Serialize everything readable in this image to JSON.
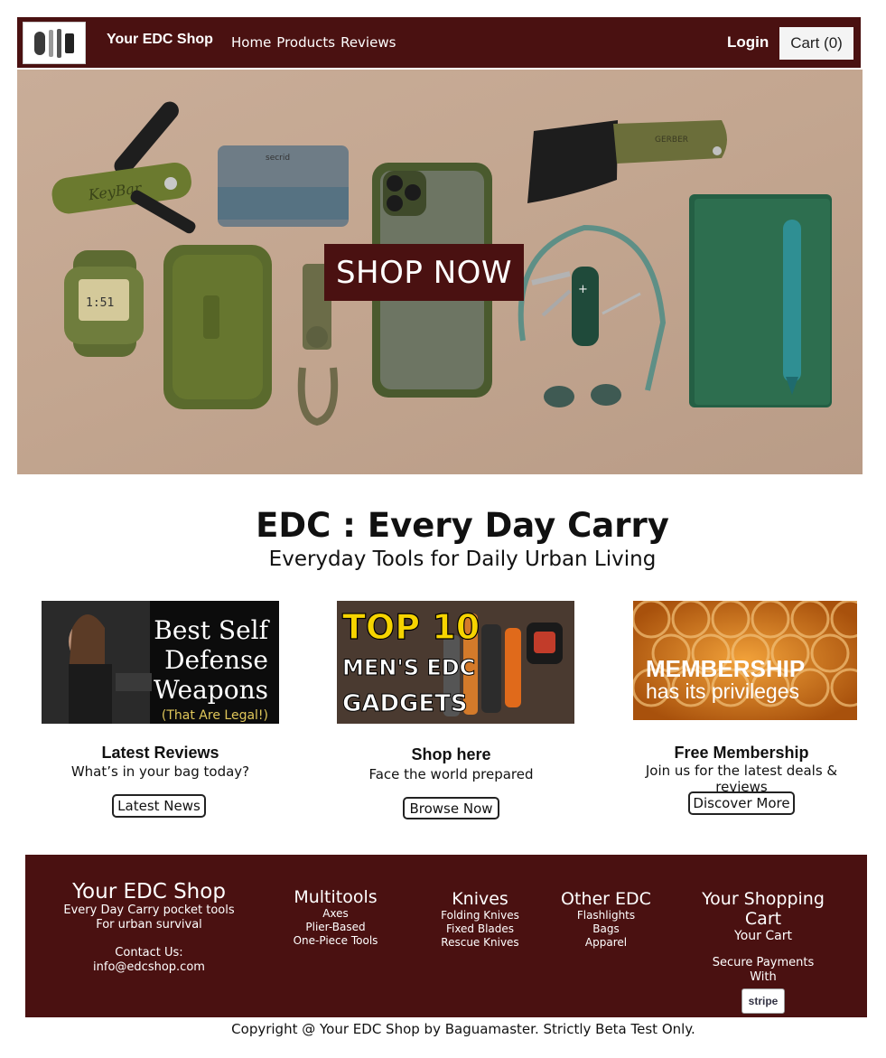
{
  "header": {
    "brand": "Your EDC Shop",
    "nav": [
      {
        "label": "Home"
      },
      {
        "label": "Products"
      },
      {
        "label": "Reviews"
      }
    ],
    "login": "Login",
    "cart": "Cart (0)"
  },
  "hero": {
    "cta": "SHOP NOW"
  },
  "intro": {
    "title": "EDC : Every Day Carry",
    "subtitle": "Everyday Tools for Daily Urban Living"
  },
  "cards": [
    {
      "image_lines": [
        "Best Self",
        "Defense",
        "Weapons",
        "(That Are Legal!)"
      ],
      "title": "Latest Reviews",
      "subtitle": "What’s in your bag today?",
      "button": "Latest News"
    },
    {
      "image_lines": [
        "TOP 10",
        "MEN'S EDC",
        "GADGETS"
      ],
      "title": "Shop here",
      "subtitle": "Face the world prepared",
      "button": "Browse Now"
    },
    {
      "image_lines": [
        "MEMBERSHIP",
        "has its privileges"
      ],
      "title": "Free Membership",
      "subtitle": "Join us for the latest deals & reviews",
      "button": "Discover More"
    }
  ],
  "footer": {
    "shop": {
      "title": "Your EDC Shop",
      "lines": [
        "Every Day Carry pocket tools",
        "For urban survival"
      ],
      "contact_label": "Contact Us:",
      "email": "info@edcshop.com"
    },
    "multitools": {
      "title": "Multitools",
      "items": [
        "Axes",
        "Plier-Based",
        "One-Piece Tools"
      ]
    },
    "knives": {
      "title": "Knives",
      "items": [
        "Folding Knives",
        "Fixed Blades",
        "Rescue Knives"
      ]
    },
    "other": {
      "title": "Other EDC",
      "items": [
        "Flashlights",
        "Bags",
        "Apparel"
      ]
    },
    "cart": {
      "title": "Your Shopping Cart",
      "link": "Your Cart",
      "secure": [
        "Secure Payments",
        "With"
      ],
      "badge": "stripe"
    }
  },
  "copyright": "Copyright @ Your EDC Shop by Baguamaster. Strictly Beta Test Only.",
  "colors": {
    "brand": "#4a1111",
    "hero_bg": "#c3a690",
    "olive": "#5f6e2c",
    "teal": "#2a7f86"
  }
}
